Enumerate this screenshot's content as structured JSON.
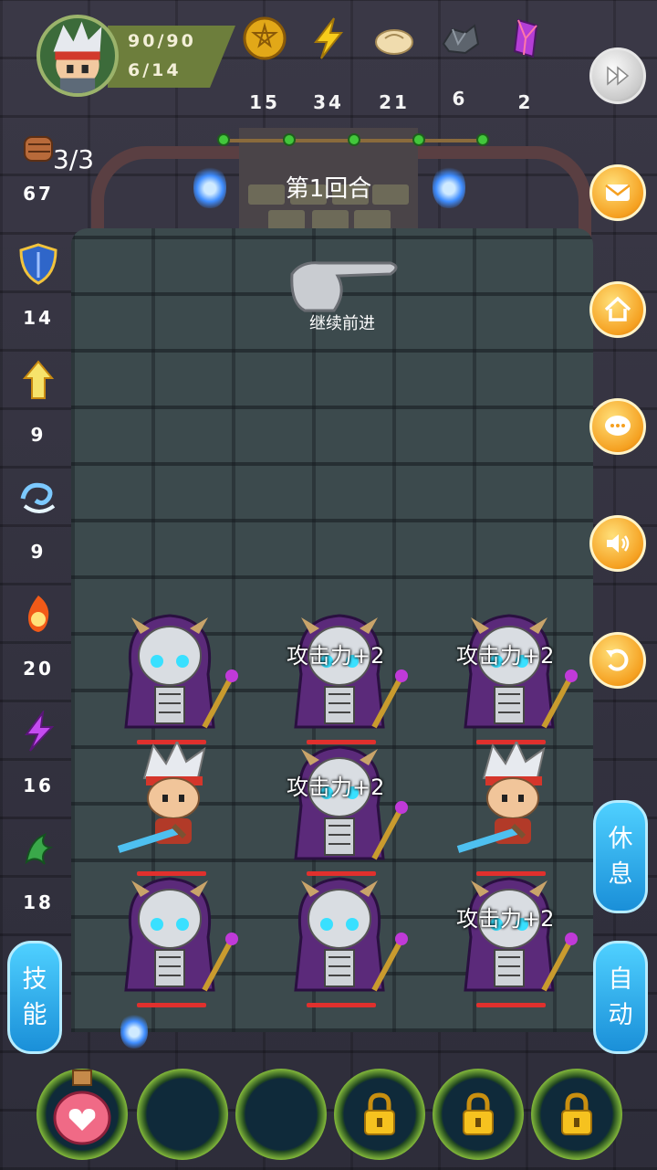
{
  "player": {
    "hp": "90/90",
    "energy": "6/14"
  },
  "resources": [
    {
      "name": "gold",
      "icon": "gold-coin-icon",
      "value": "15"
    },
    {
      "name": "energy",
      "icon": "lightning-icon",
      "value": "34"
    },
    {
      "name": "bread",
      "icon": "bread-icon",
      "value": "21"
    },
    {
      "name": "ore",
      "icon": "iron-ore-icon",
      "value": "6"
    },
    {
      "name": "crystal",
      "icon": "crystal-icon",
      "value": "2"
    }
  ],
  "stage": {
    "round_label": "第1回合",
    "progress_nodes": 5,
    "hint": "继续前进"
  },
  "left_stats": [
    {
      "icon": "fist-icon",
      "extra": "3/3",
      "value": "67"
    },
    {
      "icon": "shield-icon",
      "value": "14"
    },
    {
      "icon": "holy-arrow-icon",
      "value": "9"
    },
    {
      "icon": "wind-swirl-icon",
      "value": "9"
    },
    {
      "icon": "fireball-icon",
      "value": "20"
    },
    {
      "icon": "lightning-bolt-purple-icon",
      "value": "16"
    },
    {
      "icon": "green-claw-icon",
      "value": "18"
    }
  ],
  "buttons": {
    "skill": "技能",
    "rest": "休息",
    "auto": "自动"
  },
  "right_buttons": [
    "fast-forward-icon",
    "mail-icon",
    "home-icon",
    "chat-icon",
    "sound-icon",
    "undo-icon"
  ],
  "board": [
    {
      "row": 0,
      "col": 0,
      "unit": "skeleton-mage",
      "buff": ""
    },
    {
      "row": 0,
      "col": 1,
      "unit": "skeleton-mage",
      "buff": "攻击力+2"
    },
    {
      "row": 0,
      "col": 2,
      "unit": "skeleton-mage",
      "buff": "攻击力+2"
    },
    {
      "row": 1,
      "col": 0,
      "unit": "hero-swordsman",
      "buff": ""
    },
    {
      "row": 1,
      "col": 1,
      "unit": "skeleton-mage",
      "buff": "攻击力+2"
    },
    {
      "row": 1,
      "col": 2,
      "unit": "hero-swordsman",
      "buff": ""
    },
    {
      "row": 2,
      "col": 0,
      "unit": "skeleton-mage",
      "buff": ""
    },
    {
      "row": 2,
      "col": 1,
      "unit": "skeleton-mage",
      "buff": ""
    },
    {
      "row": 2,
      "col": 2,
      "unit": "skeleton-mage",
      "buff": "攻击力+2"
    }
  ],
  "item_slots": [
    {
      "content": "health-potion-icon",
      "locked": false
    },
    {
      "content": "",
      "locked": false
    },
    {
      "content": "",
      "locked": false
    },
    {
      "content": "lock-icon",
      "locked": true
    },
    {
      "content": "lock-icon",
      "locked": true
    },
    {
      "content": "lock-icon",
      "locked": true
    }
  ],
  "colors": {
    "accent_orange": "#f5a020",
    "accent_blue": "#1a8fd8",
    "hp_red": "#e0302d"
  }
}
